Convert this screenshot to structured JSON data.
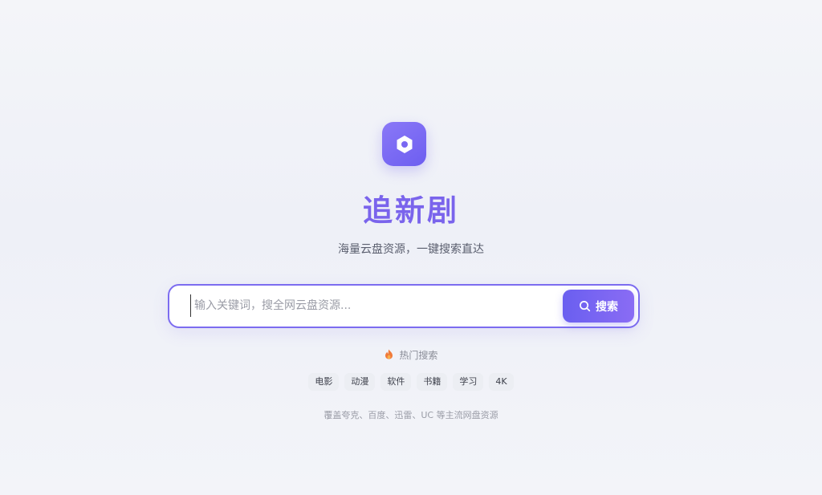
{
  "brand": {
    "title": "追新剧",
    "subtitle": "海量云盘资源，一键搜索直达",
    "logo_icon": "hexagon-icon",
    "accent_color": "#7a64ec"
  },
  "search": {
    "placeholder": "输入关键词，搜全网云盘资源...",
    "value": "",
    "button_label": "搜索",
    "button_icon": "search-icon"
  },
  "hot": {
    "title": "热门搜索",
    "icon": "fire-icon",
    "tags": [
      "电影",
      "动漫",
      "软件",
      "书籍",
      "学习",
      "4K"
    ]
  },
  "footer": {
    "note": "覆盖夸克、百度、迅雷、UC 等主流网盘资源"
  }
}
